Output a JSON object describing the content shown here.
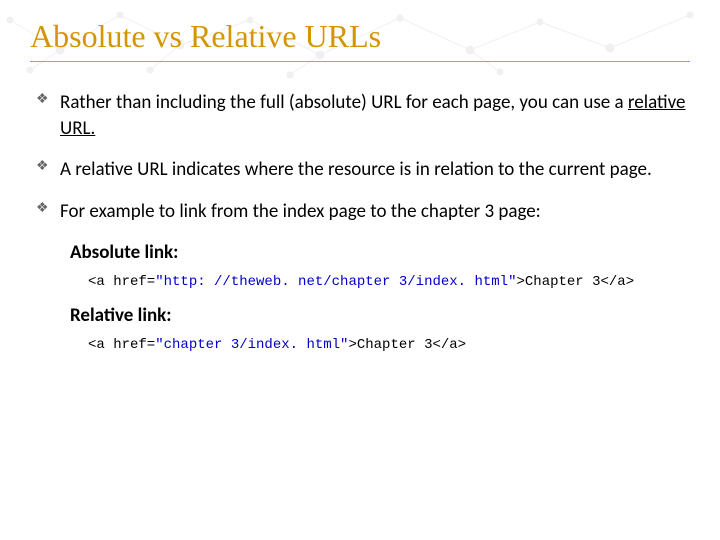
{
  "title": "Absolute vs Relative URLs",
  "bullets": {
    "b1_a": "Rather than including the full (absolute) URL for each page, you can use a ",
    "b1_b": "relative URL.",
    "b2": "A relative URL indicates where the resource is in relation to the current page.",
    "b3": "For example to link from the index page to the chapter 3 page:"
  },
  "labels": {
    "absolute": "Absolute link:",
    "relative": "Relative link:"
  },
  "code": {
    "abs_open": "<a href=",
    "abs_str": "\"http: //theweb. net/chapter 3/index. html\"",
    "abs_mid": ">Chapter 3</a>",
    "rel_open": "<a href=",
    "rel_str": "\"chapter 3/index. html\"",
    "rel_mid": ">Chapter 3</a>"
  }
}
